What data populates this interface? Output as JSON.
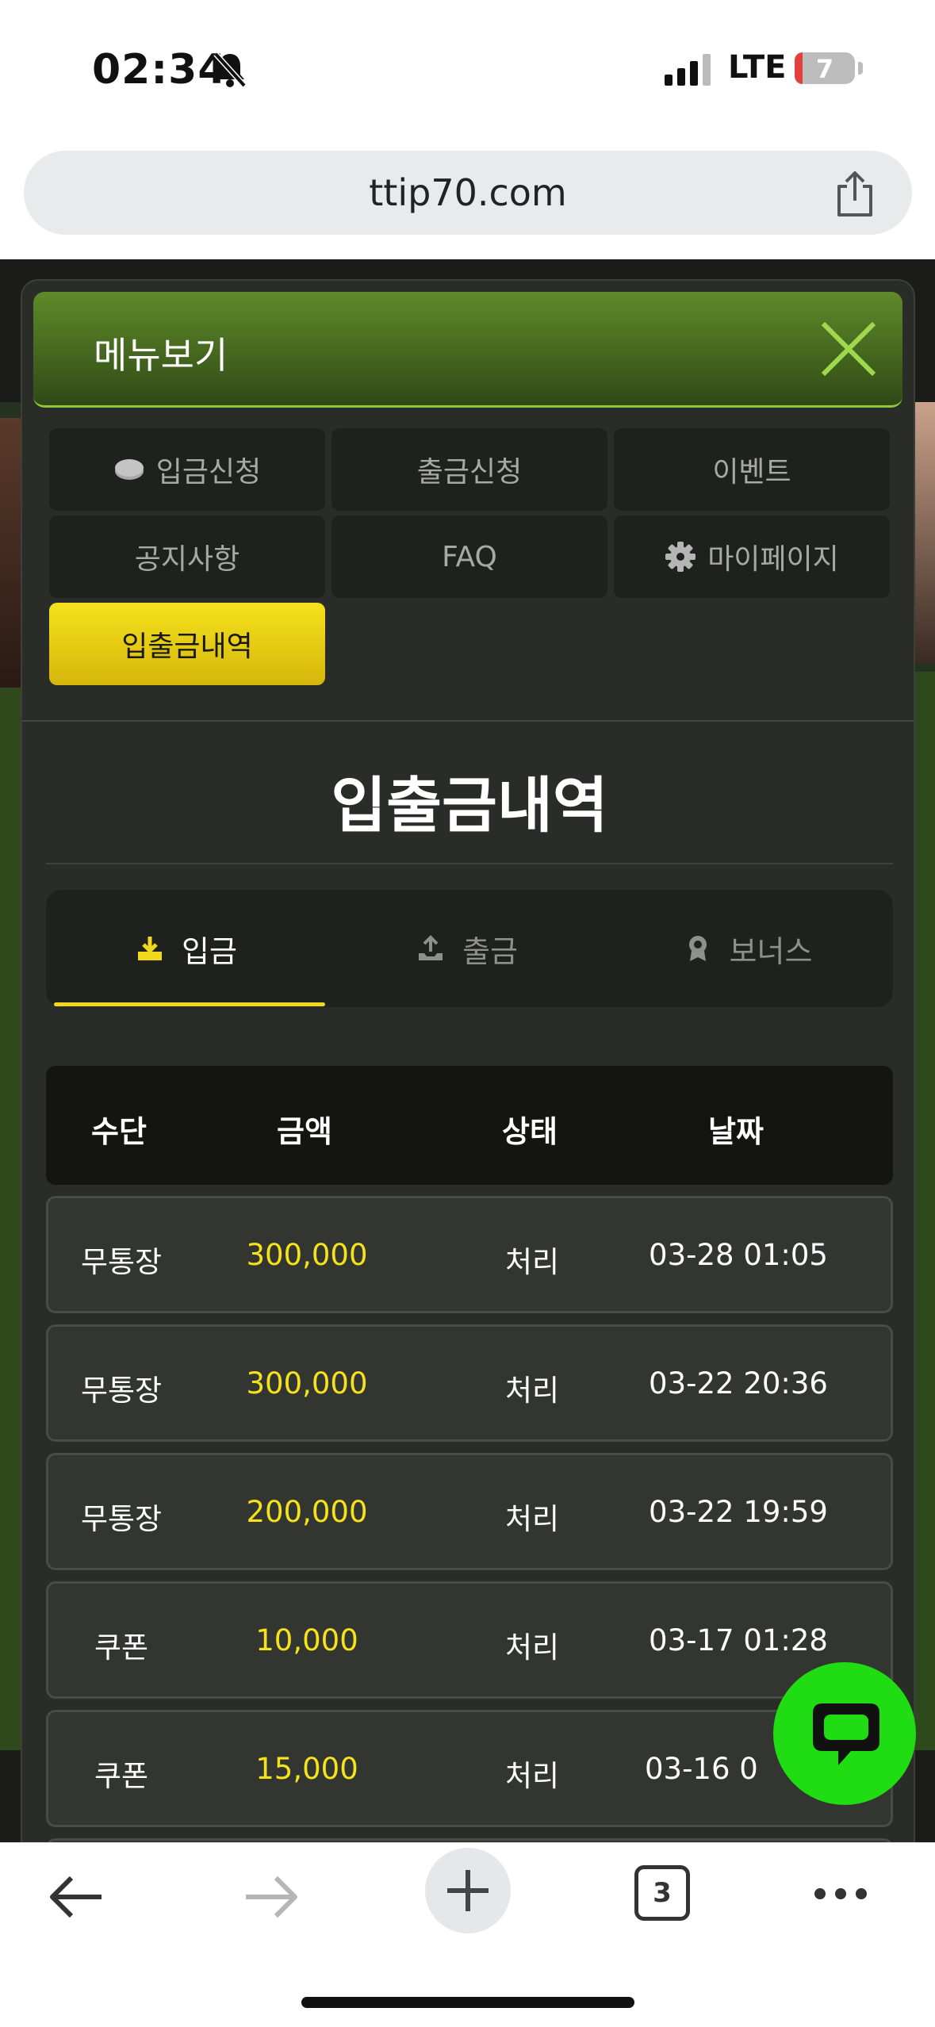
{
  "status_bar": {
    "time": "02:34",
    "network": "LTE",
    "battery": "7"
  },
  "browser": {
    "url": "ttip70.com",
    "tab_count": "3"
  },
  "modal": {
    "title": "메뉴보기",
    "menu": [
      {
        "label": "입금신청",
        "icon": "coin-icon"
      },
      {
        "label": "출금신청"
      },
      {
        "label": "이벤트"
      },
      {
        "label": "공지사항"
      },
      {
        "label": "FAQ"
      },
      {
        "label": "마이페이지",
        "icon": "gear-icon"
      },
      {
        "label": "입출금내역",
        "active": true
      }
    ]
  },
  "history": {
    "title": "입출금내역",
    "tabs": [
      {
        "label": "입금",
        "icon": "download-icon",
        "active": true
      },
      {
        "label": "출금",
        "icon": "upload-icon"
      },
      {
        "label": "보너스",
        "icon": "award-icon"
      }
    ],
    "columns": [
      "수단",
      "금액",
      "상태",
      "날짜"
    ],
    "rows": [
      {
        "method": "무통장",
        "amount": "300,000",
        "status": "처리",
        "date": "03-28 01:05"
      },
      {
        "method": "무통장",
        "amount": "300,000",
        "status": "처리",
        "date": "03-22 20:36"
      },
      {
        "method": "무통장",
        "amount": "200,000",
        "status": "처리",
        "date": "03-22 19:59"
      },
      {
        "method": "쿠폰",
        "amount": "10,000",
        "status": "처리",
        "date": "03-17 01:28"
      },
      {
        "method": "쿠폰",
        "amount": "15,000",
        "status": "처리",
        "date": "03-16 0"
      }
    ]
  },
  "colors": {
    "accent_yellow": "#f5e21b",
    "header_green": "#5f8a2a",
    "chat_green": "#1fdc13"
  }
}
